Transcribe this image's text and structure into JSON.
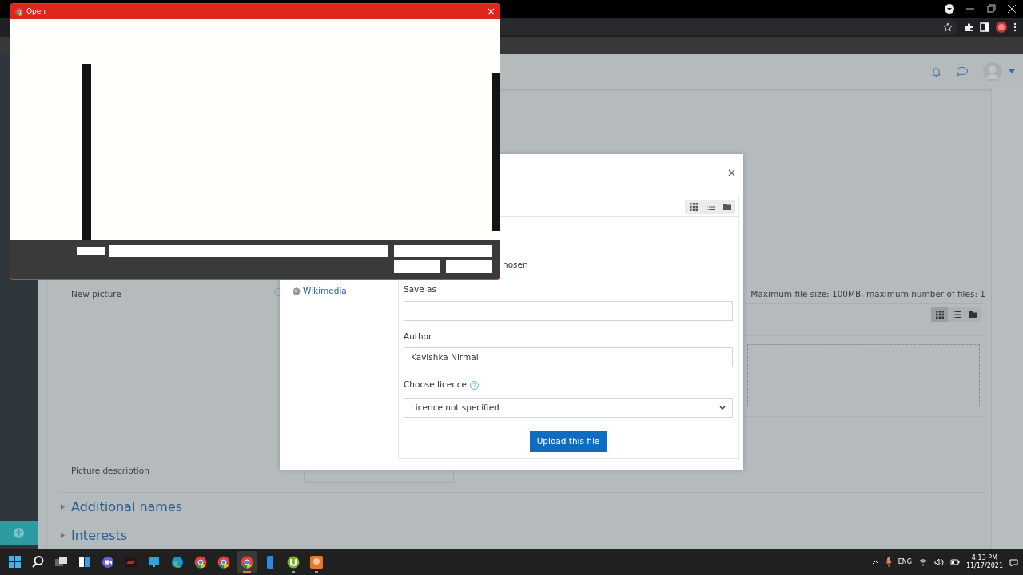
{
  "open_dialog": {
    "title": "Open"
  },
  "page": {
    "new_picture_label": "New picture",
    "file_limits": "Maximum file size: 100MB, maximum number of files: 1",
    "view_buttons": [
      {
        "kind": "grid",
        "selected": true
      },
      {
        "kind": "list",
        "selected": false
      },
      {
        "kind": "folder",
        "selected": false
      }
    ],
    "picture_description_label": "Picture description",
    "sections": [
      {
        "title": "Additional names",
        "expanded": false
      },
      {
        "title": "Interests",
        "expanded": false
      }
    ]
  },
  "file_picker": {
    "repositories": [
      {
        "label": "Wikimedia"
      }
    ],
    "view_buttons": [
      {
        "kind": "grid"
      },
      {
        "kind": "list"
      },
      {
        "kind": "folder"
      }
    ],
    "file_status": "hosen",
    "save_as_label": "Save as",
    "author_label": "Author",
    "author_value": "Kavishka Nirmal",
    "licence_label": "Choose licence",
    "licence_value": "Licence not specified",
    "upload_button": "Upload this file"
  },
  "taskbar": {
    "apps": [
      {
        "kind": "start",
        "selected": false,
        "running": false
      },
      {
        "kind": "search",
        "selected": false,
        "running": false
      },
      {
        "kind": "taskview",
        "selected": false,
        "running": false
      },
      {
        "kind": "widgets",
        "selected": false,
        "running": false
      },
      {
        "kind": "chat",
        "selected": false,
        "running": false
      },
      {
        "kind": "game",
        "selected": false,
        "running": false
      },
      {
        "kind": "monitor",
        "selected": false,
        "running": false
      },
      {
        "kind": "edge",
        "selected": false,
        "running": false
      },
      {
        "kind": "chrome",
        "selected": false,
        "running": false
      },
      {
        "kind": "chrome",
        "selected": false,
        "running": false
      },
      {
        "kind": "chrome",
        "selected": true,
        "running": false
      },
      {
        "kind": "phone",
        "selected": false,
        "running": false
      },
      {
        "kind": "torrent",
        "selected": false,
        "running": true
      },
      {
        "kind": "orange",
        "selected": false,
        "running": true
      }
    ],
    "language": "ENG",
    "time": "4:13 PM",
    "date": "11/17/2021"
  }
}
